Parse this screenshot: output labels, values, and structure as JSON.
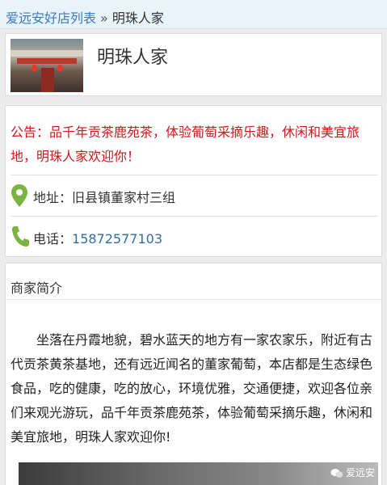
{
  "breadcrumb": {
    "parent": "爱远安好店列表",
    "separator": "»",
    "current": "明珠人家"
  },
  "shop": {
    "name": "明珠人家"
  },
  "info": {
    "notice": "公告：品千年贡茶鹿苑茶，体验葡萄采摘乐趣，休闲和美宜旅地，明珠人家欢迎你！",
    "address_label": "地址：",
    "address_value": "旧县镇董家村三组",
    "phone_label": "电话：",
    "phone_value": "15872577103"
  },
  "intro": {
    "title": "商家简介",
    "body": "坐落在丹霞地貌，碧水蓝天的地方有一家农家乐，附近有古代贡茶黄茶基地，还有远近闻名的董家葡萄，本店都是生态绿色食品，吃的健康，吃的放心，环境优雅，交通便捷，欢迎各位亲们来观光游玩，品千年贡茶鹿苑茶，体验葡萄采摘乐趣，休闲和美宜旅地，明珠人家欢迎你!"
  },
  "watermark": {
    "text": "爱远安"
  },
  "colors": {
    "link_blue": "#3a7bbd",
    "notice_red": "#d0171b",
    "icon_green": "#7cb342",
    "phone_blue": "#2f6ea6"
  },
  "icons": {
    "location": "map-pin-icon",
    "phone": "phone-icon"
  }
}
